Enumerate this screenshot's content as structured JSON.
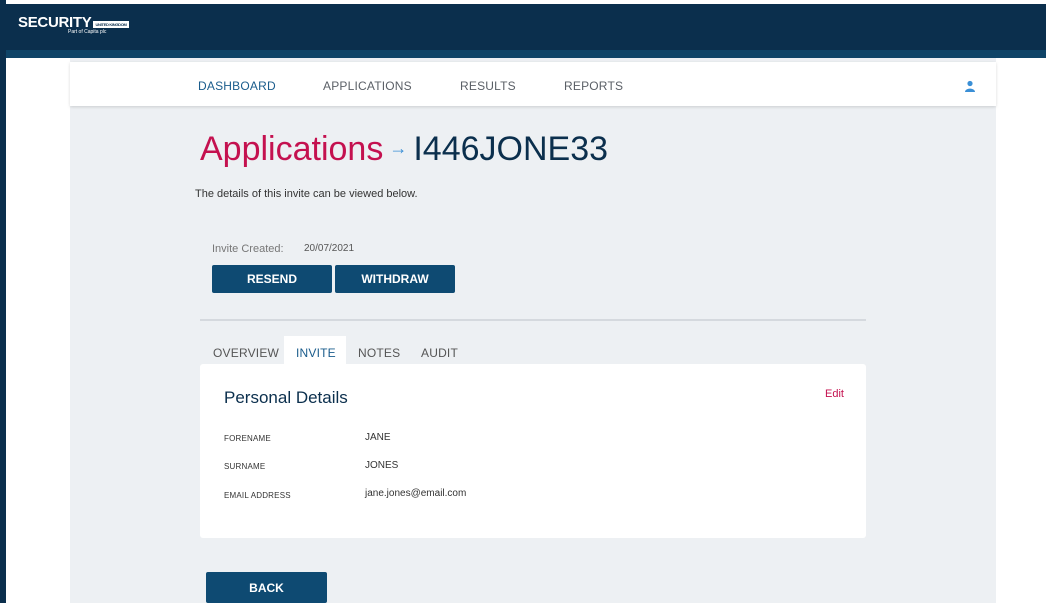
{
  "brand": {
    "logo_text": "SECURITY",
    "logo_tag": "UNITED KINGDOM",
    "logo_sub": "Part of Capita plc"
  },
  "nav": {
    "items": [
      {
        "label": "DASHBOARD",
        "active": true
      },
      {
        "label": "APPLICATIONS",
        "active": false
      },
      {
        "label": "RESULTS",
        "active": false
      },
      {
        "label": "REPORTS",
        "active": false
      }
    ],
    "user_icon": "user-icon"
  },
  "page": {
    "title": "Applications",
    "arrow": "→",
    "invite_id": "I446JONE33",
    "lead_text": "The details of this invite can be viewed below."
  },
  "invite": {
    "created_label": "Invite Created:",
    "created_value": "20/07/2021",
    "resend_label": "RESEND",
    "withdraw_label": "WITHDRAW"
  },
  "tabs": [
    {
      "label": "OVERVIEW",
      "active": false
    },
    {
      "label": "INVITE",
      "active": true
    },
    {
      "label": "NOTES",
      "active": false
    },
    {
      "label": "AUDIT",
      "active": false
    }
  ],
  "personal_details": {
    "title": "Personal Details",
    "edit_label": "Edit",
    "rows": [
      {
        "label": "FORENAME",
        "value": "JANE"
      },
      {
        "label": "SURNAME",
        "value": "JONES"
      },
      {
        "label": "EMAIL ADDRESS",
        "value": "jane.jones@email.com"
      }
    ]
  },
  "back_label": "BACK",
  "colors": {
    "navy": "#0b2f4d",
    "accent_pink": "#c4114f",
    "button": "#0e4a72",
    "active_link": "#1a5c8c"
  }
}
